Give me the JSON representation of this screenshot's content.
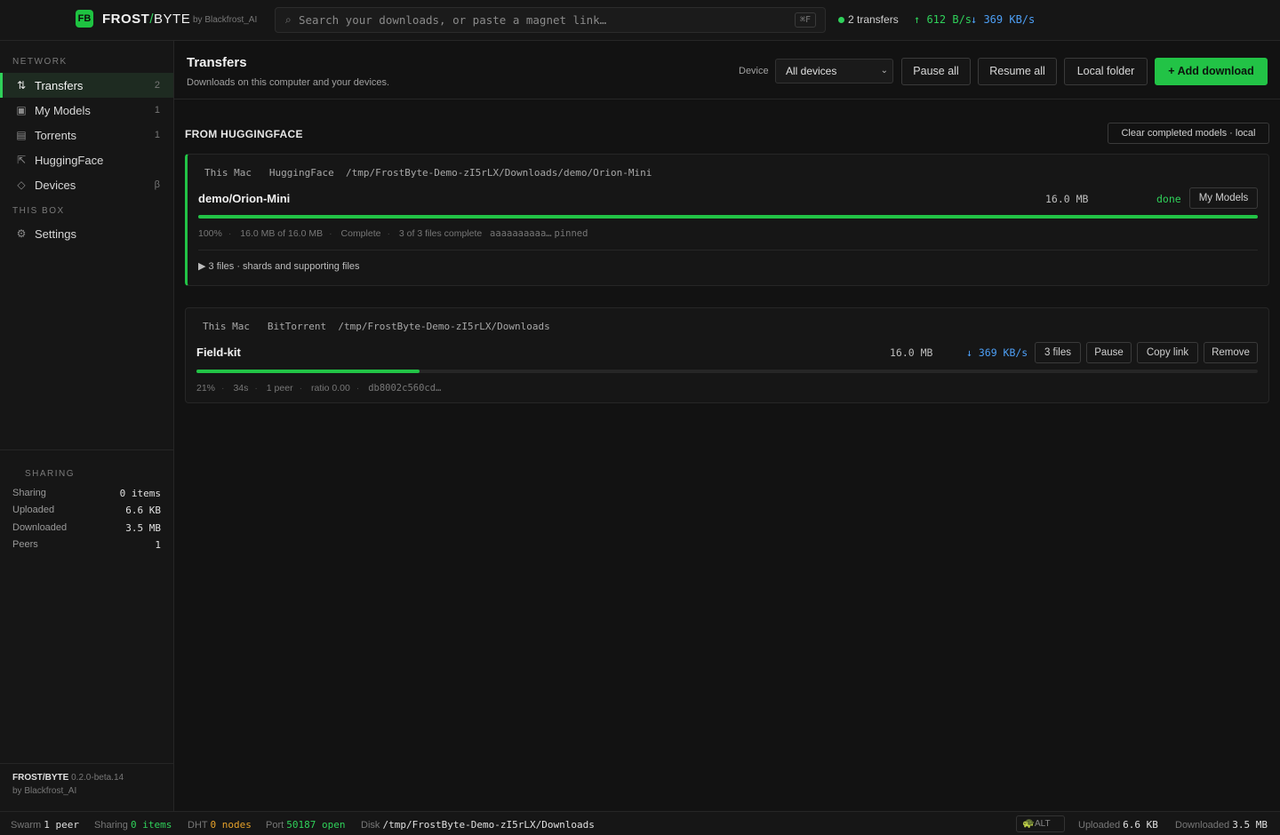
{
  "app": {
    "logo_glyph": "FB",
    "brand_main": "FROST",
    "brand_slash": "/",
    "brand_rest": "BYTE",
    "by": "by Blackfrost_AI",
    "accent": "#22c346",
    "download_color": "#4d9ff5"
  },
  "topbar": {
    "search_placeholder": "Search your downloads, or paste a magnet link…",
    "shortcut": "⌘F",
    "transfers_count": "2 transfers",
    "up_speed": "↑ 612 B/s",
    "down_speed": "↓ 369 KB/s"
  },
  "sidebar": {
    "network_label": "NETWORK",
    "items": [
      {
        "label": "Transfers",
        "badge": "2",
        "icon": "arrows-updown-icon"
      },
      {
        "label": "My Models",
        "badge": "1",
        "icon": "model-icon"
      },
      {
        "label": "Torrents",
        "badge": "1",
        "icon": "torrent-icon"
      },
      {
        "label": "HuggingFace",
        "badge": "",
        "icon": "huggingface-icon"
      },
      {
        "label": "Devices",
        "badge": "β",
        "icon": "diamond-icon"
      }
    ],
    "box_label": "THIS BOX",
    "settings_label": "Settings",
    "sharing": {
      "title": "SHARING",
      "rows": [
        {
          "label": "Sharing",
          "value": "0 items"
        },
        {
          "label": "Uploaded",
          "value": "6.6 KB"
        },
        {
          "label": "Downloaded",
          "value": "3.5 MB"
        },
        {
          "label": "Peers",
          "value": "1"
        }
      ]
    },
    "version_name": "FROST/BYTE",
    "version_number": "0.2.0-beta.14",
    "version_by": "by Blackfrost_AI"
  },
  "main": {
    "title": "Transfers",
    "subtitle": "Downloads on this computer and your devices.",
    "device_label": "Device",
    "device_value": "All devices",
    "pause_all": "Pause all",
    "resume_all": "Resume all",
    "local_folder": "Local folder",
    "add_download": "+ Add download",
    "section_title": "FROM HUGGINGFACE",
    "clear_completed": "Clear completed models · local"
  },
  "transfers": [
    {
      "device": "This Mac",
      "source": "HuggingFace",
      "path": "/tmp/FrostByte-Demo-zI5rLX/Downloads/demo/Orion-Mini",
      "name": "demo/Orion-Mini",
      "size": "16.0 MB",
      "state": "done",
      "action": "My Models",
      "progress": 1.0,
      "percent": "100%",
      "amount": "16.0 MB of 16.0 MB",
      "status": "Complete",
      "files_complete": "3 of 3 files complete",
      "hash": "aaaaaaaaaa…",
      "pinned": "pinned",
      "files_summary": "3 files · shards and supporting files"
    },
    {
      "device": "This Mac",
      "source": "BitTorrent",
      "path": "/tmp/FrostByte-Demo-zI5rLX/Downloads",
      "name": "Field-kit",
      "size": "16.0 MB",
      "rate": "↓ 369 KB/s",
      "btn_files": "3 files",
      "btn_pause": "Pause",
      "btn_copy": "Copy link",
      "btn_remove": "Remove",
      "progress": 0.21,
      "percent": "21%",
      "eta": "34s",
      "peers": "1 peer",
      "ratio": "ratio 0.00",
      "hash": "db8002c560cd…"
    }
  ],
  "statusbar": {
    "swarm_label": "Swarm",
    "swarm_value": "1 peer",
    "sharing_label": "Sharing",
    "sharing_value": "0 items",
    "dht_label": "DHT",
    "dht_value": "0 nodes",
    "port_label": "Port",
    "port_value": "50187 open",
    "disk_label": "Disk",
    "disk_value": "/tmp/FrostByte-Demo-zI5rLX/Downloads",
    "alt_label": "ALT",
    "uploaded_label": "Uploaded",
    "uploaded_value": "6.6 KB",
    "downloaded_label": "Downloaded",
    "downloaded_value": "3.5 MB"
  }
}
